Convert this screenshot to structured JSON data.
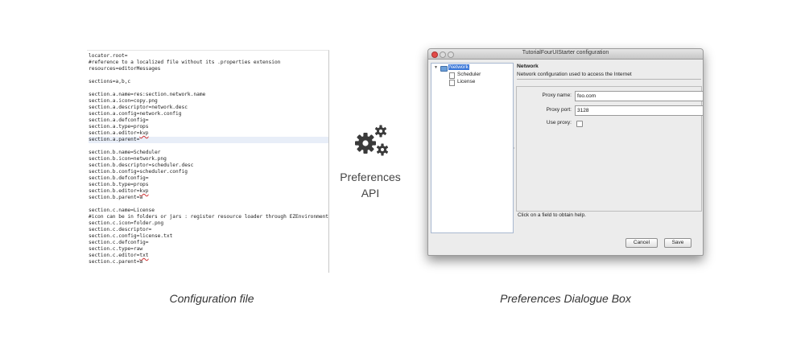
{
  "config_file": {
    "lines": [
      "locator.root=",
      "#reference to a localized file without its .properties extension",
      "resources=editorMessages",
      "",
      "sections=a,b,c",
      "",
      "section.a.name=res:section.network.name",
      "section.a.icon=copy.png",
      "section.a.descriptor=network.desc",
      "section.a.config=network.config",
      "section.a.defconfig=",
      "section.a.type=props",
      "section.a.editor=kvp",
      "section.a.parent=",
      "",
      "section.b.name=Scheduler",
      "section.b.icon=network.png",
      "section.b.descriptor=scheduler.desc",
      "section.b.config=scheduler.config",
      "section.b.defconfig=",
      "section.b.type=props",
      "section.b.editor=kvp",
      "section.b.parent=a",
      "",
      "section.c.name=License",
      "#icon can be in folders or jars : register resource loader through EZEnvironment",
      "section.c.icon=folder.png",
      "section.c.descriptor=",
      "section.c.config=license.txt",
      "section.c.defconfig=",
      "section.c.type=raw",
      "section.c.editor=txt",
      "section.c.parent=a"
    ],
    "highlighted_line_index": 13,
    "squiggle_words": [
      "kvp",
      "txt"
    ]
  },
  "captions": {
    "config": "Configuration file",
    "dialog": "Preferences Dialogue Box"
  },
  "api": {
    "line1": "Preferences",
    "line2": "API",
    "icon": "gears-icon"
  },
  "dialog": {
    "title": "TutorialFourUIStarter configuration",
    "tree": [
      {
        "label": "Network",
        "icon": "folder-icon",
        "selected": true
      },
      {
        "label": "Scheduler",
        "icon": "doc-icon",
        "selected": false
      },
      {
        "label": "License",
        "icon": "doc-icon",
        "selected": false
      }
    ],
    "panel_title": "Network",
    "panel_desc": "Network configuration used to access the Internet",
    "fields": {
      "proxy_name_label": "Proxy name:",
      "proxy_name_value": "foo.com",
      "proxy_port_label": "Proxy port:",
      "proxy_port_value": "3128",
      "use_proxy_label": "Use proxy:",
      "use_proxy_checked": false
    },
    "help_text": "Click on a field to obtain help.",
    "buttons": {
      "cancel": "Cancel",
      "save": "Save"
    }
  },
  "colors": {
    "selection": "#3875d7",
    "close_button": "#e24b47",
    "folder": "#6c9fd8"
  }
}
